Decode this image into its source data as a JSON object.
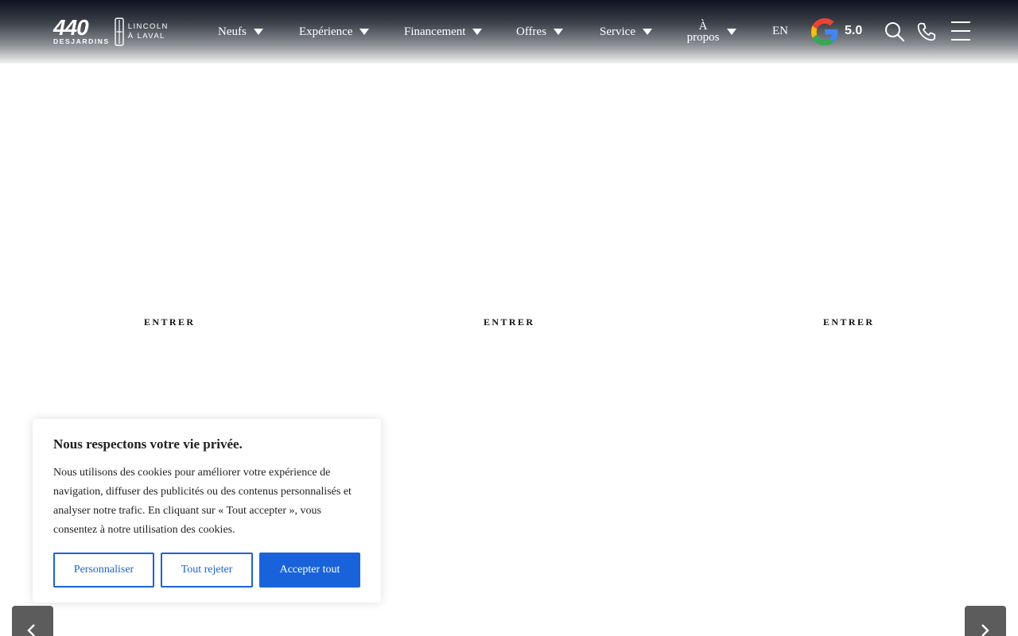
{
  "header": {
    "logo": {
      "number": "440",
      "subtitle": "DESJARDINS",
      "line1": "LINCOLN",
      "line2": "À LAVAL"
    },
    "nav": [
      {
        "label": "Neufs"
      },
      {
        "label": "Expérience"
      },
      {
        "label": "Financement"
      },
      {
        "label": "Offres"
      },
      {
        "label": "Service"
      },
      {
        "label": "À propos"
      }
    ],
    "language": "EN",
    "google_rating": "5.0",
    "icons": [
      "google-icon",
      "search-icon",
      "phone-icon",
      "menu-icon"
    ]
  },
  "panels": [
    {
      "link_label": "ENTRER"
    },
    {
      "link_label": "ENTRER"
    },
    {
      "link_label": "ENTRER"
    }
  ],
  "cookie_banner": {
    "title": "Nous respectons votre vie privée.",
    "body": "Nous utilisons des cookies pour améliorer votre expérience de navigation, diffuser des publicités ou des contenus personnalisés et analyser notre trafic. En cliquant sur « Tout accepter », vous consentez à notre utilisation des cookies.",
    "customize_label": "Personnaliser",
    "reject_label": "Tout rejeter",
    "accept_label": "Accepter tout"
  },
  "colors": {
    "accent": "#1863dc",
    "arrow_bg": "#5c5c5c"
  }
}
